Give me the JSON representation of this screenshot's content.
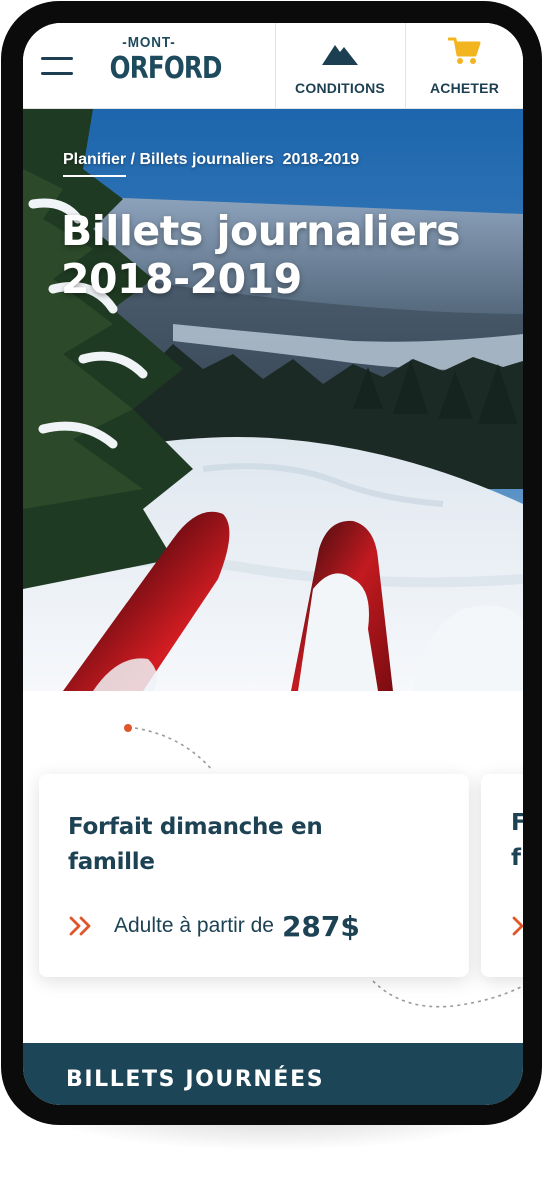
{
  "header": {
    "logo_top": "-MONT-",
    "logo_bottom": "ORFORD",
    "nav": [
      {
        "label": "CONDITIONS",
        "icon": "mountain-icon"
      },
      {
        "label": "ACHETER",
        "icon": "shopping-cart-icon"
      }
    ]
  },
  "hero": {
    "breadcrumb_link": "Planifier",
    "breadcrumb_separator": " / ",
    "breadcrumb_current": "Billets journaliers  2018-2019",
    "title": "Billets journaliers 2018-2019"
  },
  "cards": [
    {
      "title": "Forfait dimanche en famille",
      "price_prefix": "Adulte à partir de",
      "price": "287$",
      "icon": "double-chevron-right-icon"
    },
    {
      "title_line1": "F",
      "title_line2": "f"
    }
  ],
  "section": {
    "title": "BILLETS JOURNÉES"
  },
  "colors": {
    "brand_navy": "#1d4254",
    "band_navy": "#1c4557",
    "accent_orange": "#e0562a",
    "cart_yellow": "#f2b51f"
  }
}
